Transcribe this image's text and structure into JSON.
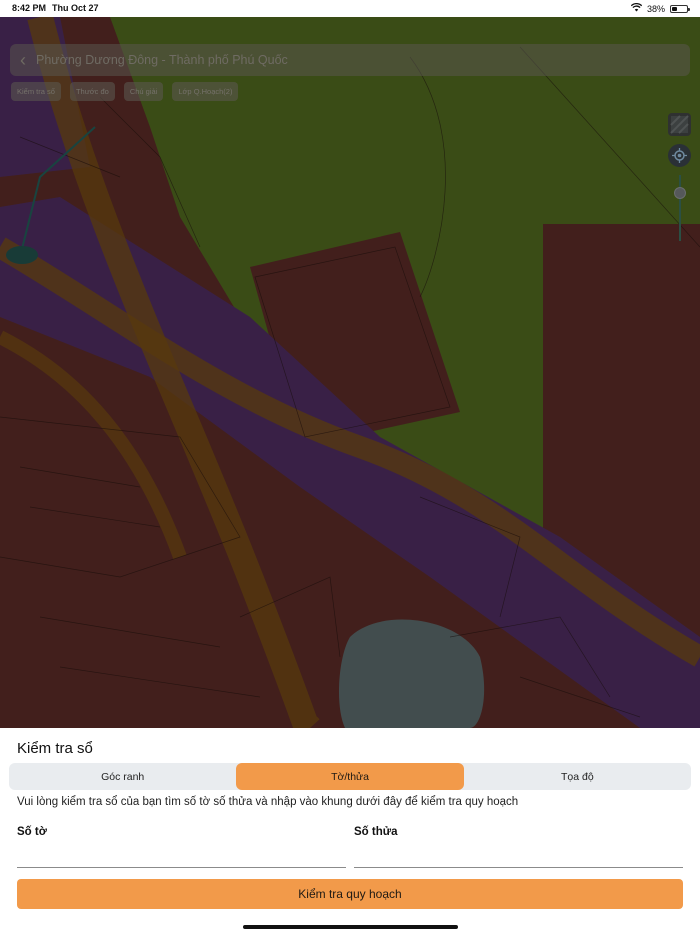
{
  "status_bar": {
    "time": "8:42 PM",
    "date": "Thu Oct 27",
    "battery_percent": "38%",
    "battery_level": 0.38
  },
  "map": {
    "location_title": "Phường Dương Đông - Thành phố Phú Quốc",
    "chips": [
      "Kiểm tra số",
      "Thước đo",
      "Chú giải",
      "Lớp Q.Hoạch(2)"
    ],
    "colors": {
      "green_zone": "#6b8c2a",
      "residential_zone": "#7a3a34",
      "road_zone": "#6a3c82",
      "road_buffer": "#a26a18",
      "water": "#7b8f91",
      "overlay": "rgba(0,0,0,0.46)"
    }
  },
  "sheet": {
    "title": "Kiểm tra sổ",
    "tabs": [
      {
        "label": "Góc ranh",
        "active": false
      },
      {
        "label": "Tờ/thửa",
        "active": true
      },
      {
        "label": "Tọa độ",
        "active": false
      }
    ],
    "instruction": "Vui lòng kiểm tra sổ của bạn tìm số tờ số thửa và nhập vào khung dưới đây để kiểm tra quy hoạch",
    "field_so_to": {
      "label": "Số tờ",
      "value": ""
    },
    "field_so_thua": {
      "label": "Số thửa",
      "value": ""
    },
    "submit_label": "Kiểm tra quy hoạch"
  }
}
